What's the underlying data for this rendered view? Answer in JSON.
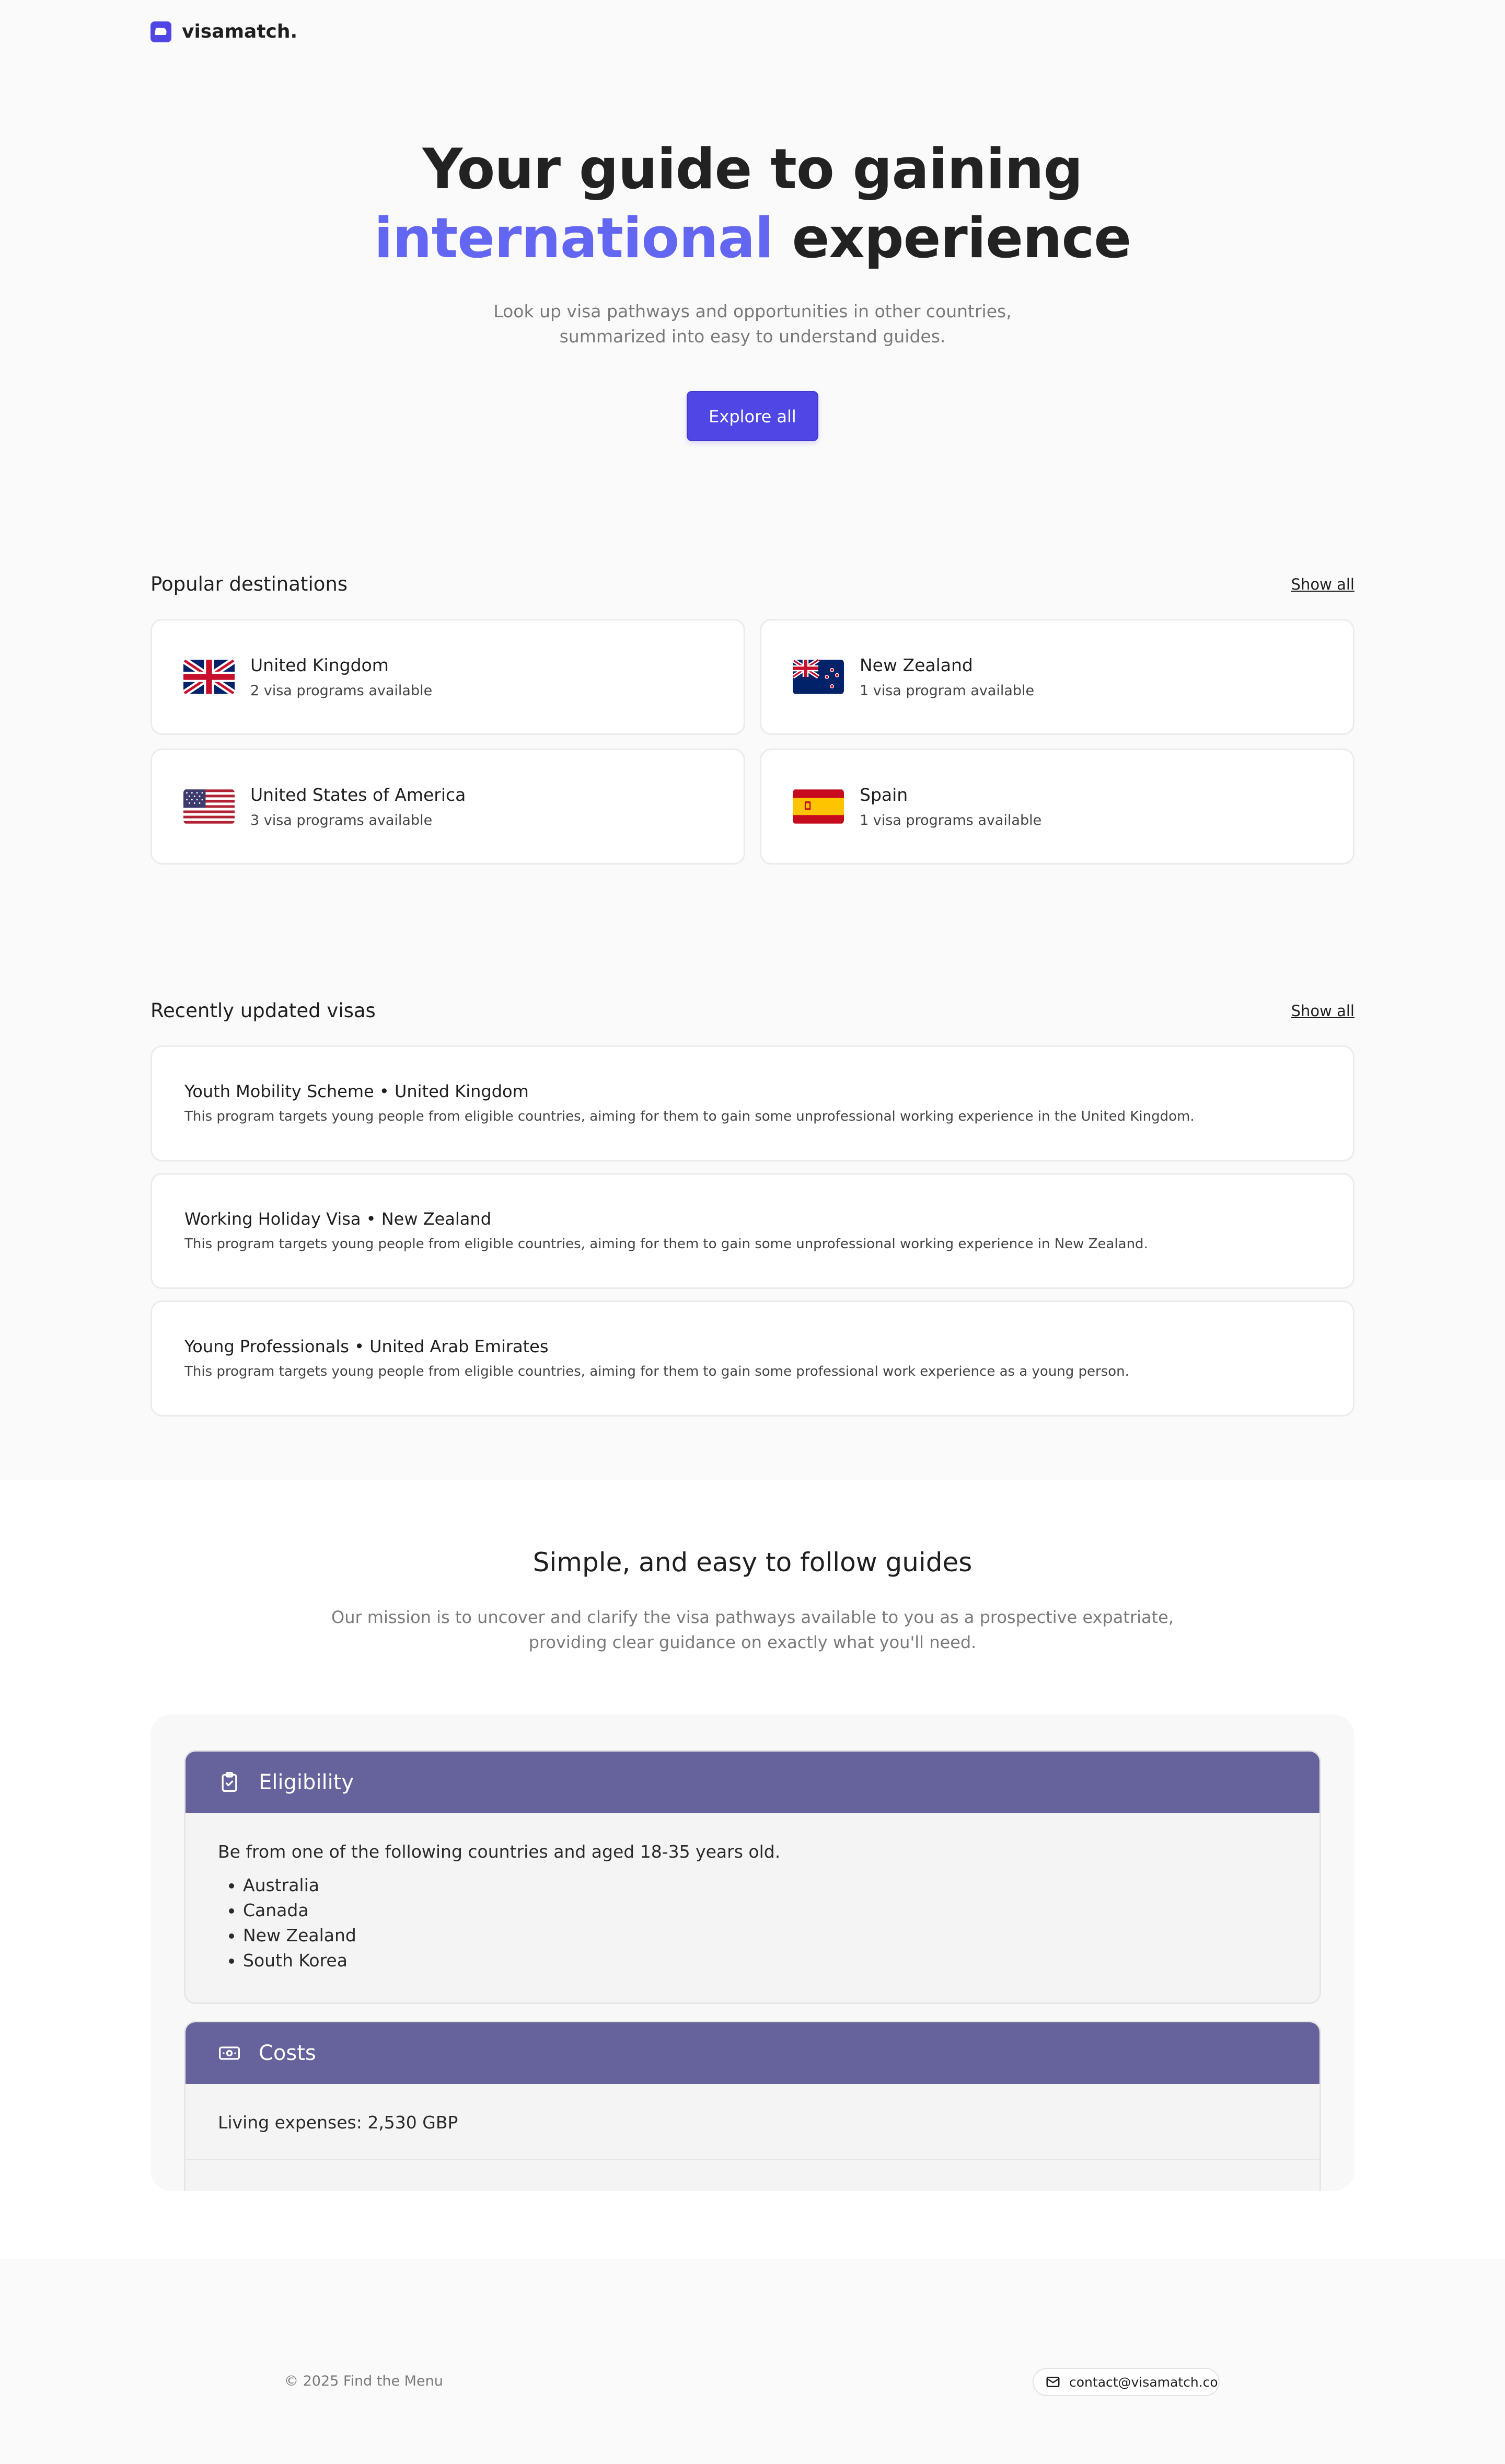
{
  "brand": {
    "name": "visamatch."
  },
  "hero": {
    "title_line1": "Your guide to gaining",
    "title_accent": "international",
    "title_rest": "experience",
    "subtitle": "Look up visa pathways and opportunities in other countries, summarized into easy to understand guides.",
    "cta": "Explore all"
  },
  "destinations": {
    "title": "Popular destinations",
    "show_all": "Show all",
    "items": [
      {
        "name": "United Kingdom",
        "sub": "2 visa programs available",
        "flag": "uk-flag-icon"
      },
      {
        "name": "New Zealand",
        "sub": "1 visa program available",
        "flag": "nz-flag-icon"
      },
      {
        "name": "United States of America",
        "sub": "3 visa programs available",
        "flag": "us-flag-icon"
      },
      {
        "name": "Spain",
        "sub": "1 visa programs available",
        "flag": "es-flag-icon"
      }
    ]
  },
  "visas": {
    "title": "Recently updated visas",
    "show_all": "Show all",
    "items": [
      {
        "title": "Youth Mobility Scheme • United Kingdom",
        "desc": "This program targets young people from eligible countries, aiming for them to gain some unprofessional working experience in the United Kingdom."
      },
      {
        "title": "Working Holiday Visa • New Zealand",
        "desc": "This program targets young people from eligible countries, aiming for them to gain some unprofessional working experience in New Zealand."
      },
      {
        "title": "Young Professionals • United Arab Emirates",
        "desc": "This program targets young people from eligible countries, aiming for them to gain some professional work experience as a young person."
      }
    ]
  },
  "mission": {
    "title": "Simple, and easy to follow guides",
    "text": "Our mission is to uncover and clarify the visa pathways available to you as a prospective expatriate, providing clear guidance on exactly what you'll need."
  },
  "eligibility": {
    "title": "Eligibility",
    "intro": "Be from one of the following countries and aged 18-35 years old.",
    "countries": [
      "Australia",
      "Canada",
      "New Zealand",
      "South Korea"
    ]
  },
  "costs": {
    "title": "Costs",
    "living": "Living expenses: 2,530 GBP"
  },
  "footer": {
    "copyright": "© 2025 Find the Menu",
    "email": "contact@visamatch.co"
  },
  "colors": {
    "accent": "#4f46e5",
    "accent_text": "#6366f1",
    "panel_header": "#66629b"
  }
}
